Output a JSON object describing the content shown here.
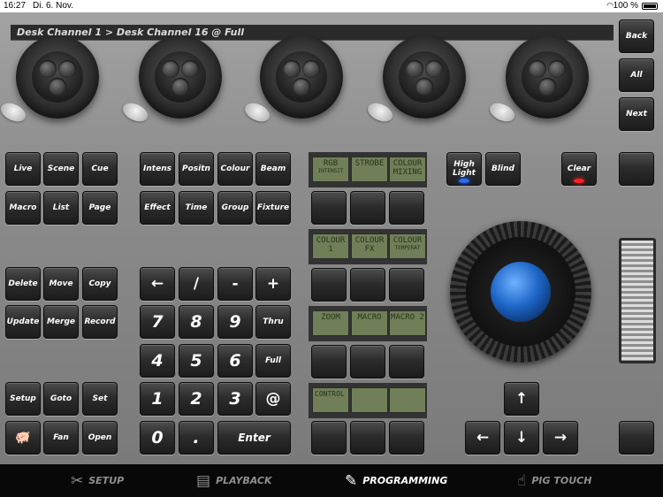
{
  "status_bar": {
    "time": "16:27",
    "date": "Di. 6. Nov.",
    "battery": "100 %"
  },
  "command_line": "Desk Channel 1 > Desk Channel 16 @ Full",
  "nav_keys": [
    "Back",
    "All",
    "Next"
  ],
  "playback_keys": [
    "Live",
    "Scene",
    "Cue",
    "Macro",
    "List",
    "Page"
  ],
  "feature_keys": [
    "Intens",
    "Positn",
    "Colour",
    "Beam",
    "Effect",
    "Time",
    "Group",
    "Fixture"
  ],
  "edit_keys": [
    "Delete",
    "Move",
    "Copy",
    "Update",
    "Merge",
    "Record"
  ],
  "setup_keys": [
    "Setup",
    "Goto",
    "Set",
    "",
    "Fan",
    "Open"
  ],
  "numpad": [
    "←",
    "/",
    "-",
    "+",
    "7",
    "8",
    "9",
    "Thru",
    "4",
    "5",
    "6",
    "Full",
    "1",
    "2",
    "3",
    "@",
    "0",
    ".",
    "Enter"
  ],
  "lcd_rows": [
    [
      {
        "main": "RGB",
        "sub": "INTENSIT"
      },
      {
        "main": "STROBE",
        "sub": ""
      },
      {
        "main": "COLOUR MIXING",
        "sub": ""
      }
    ],
    [
      {
        "main": "COLOUR 1",
        "sub": ""
      },
      {
        "main": "COLOUR FX",
        "sub": ""
      },
      {
        "main": "COLOUR",
        "sub": "TEMPERAT"
      }
    ],
    [
      {
        "main": "ZOOM",
        "sub": ""
      },
      {
        "main": "MACRO",
        "sub": ""
      },
      {
        "main": "MACRO 2",
        "sub": ""
      }
    ],
    [
      {
        "main": "CONTROL",
        "sub": ""
      },
      {
        "main": "",
        "sub": ""
      },
      {
        "main": "",
        "sub": ""
      }
    ]
  ],
  "special_keys": {
    "highlight": "High Light",
    "blind": "Blind",
    "clear": "Clear"
  },
  "arrow_keys": [
    "↑",
    "←",
    "↓",
    "→"
  ],
  "led_colors": {
    "highlight": "#2a6bff",
    "clear": "#ff2020"
  },
  "tabs": [
    {
      "label": "SETUP",
      "icon": "tools-icon",
      "active": false
    },
    {
      "label": "PLAYBACK",
      "icon": "clapperboard-icon",
      "active": false
    },
    {
      "label": "PROGRAMMING",
      "icon": "pencil-icon",
      "active": true
    },
    {
      "label": "PIG TOUCH",
      "icon": "touch-hand-icon",
      "active": false
    }
  ]
}
